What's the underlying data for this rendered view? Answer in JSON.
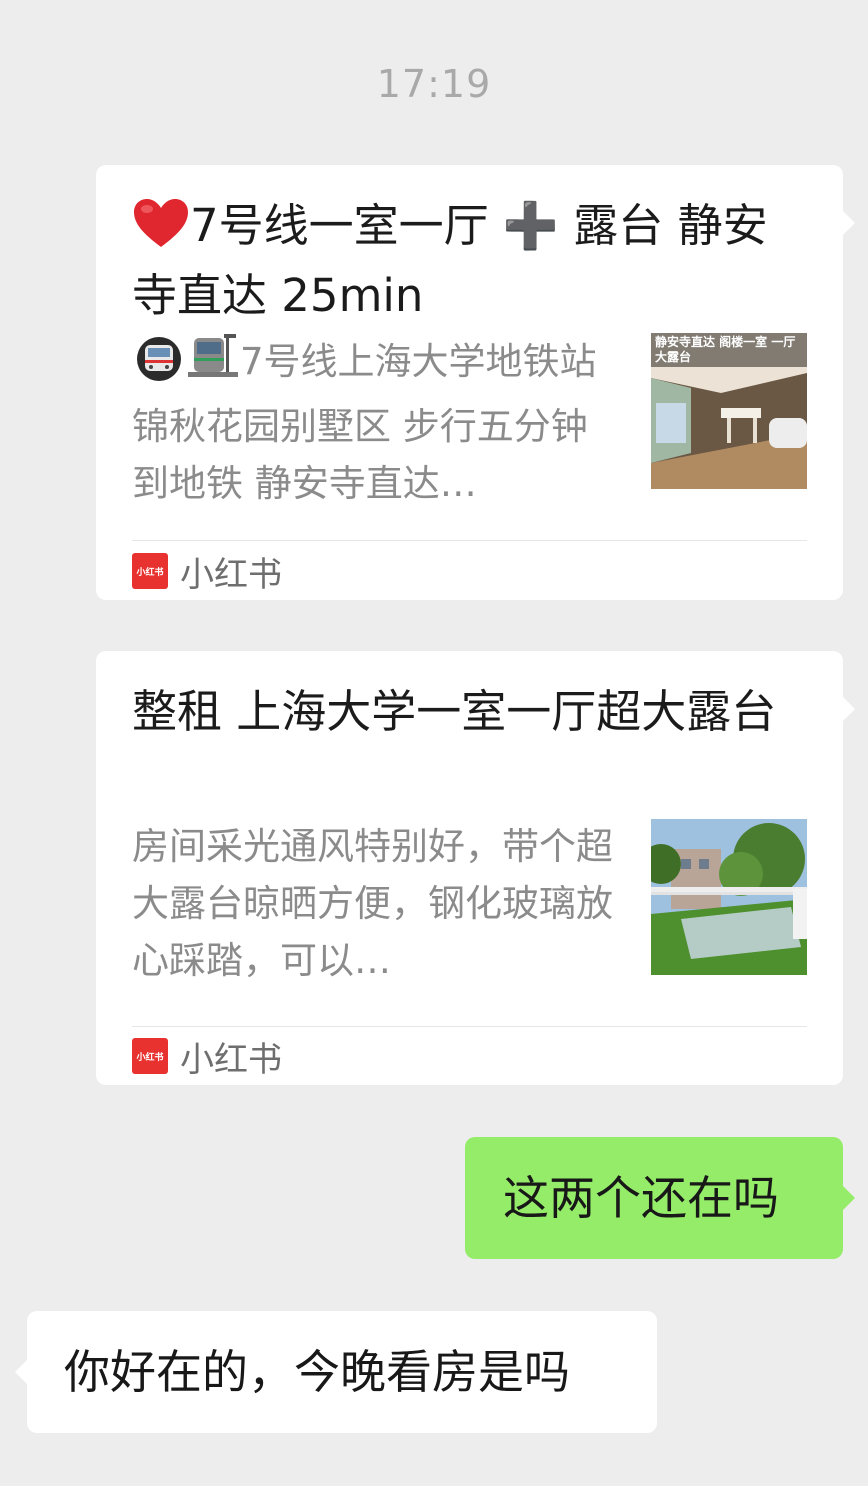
{
  "chat": {
    "timestamp": "17:19",
    "cards": [
      {
        "title_emoji": "heart-emoji",
        "title": "7号线一室一厅 ➕ 露台 静安寺直达 25min",
        "desc_emojis": [
          "metro-emoji",
          "train-emoji"
        ],
        "description": "7号线上海大学地铁站 锦秋花园别墅区 步行五分钟到地铁 静安寺直达…",
        "thumbnail_caption": "静安寺直达 阁楼一室 一厅 大露台",
        "source": "小红书",
        "source_logo_text": "小红书"
      },
      {
        "title": "整租 上海大学一室一厅超大露台",
        "description": "房间采光通风特别好，带个超大露台晾晒方便，钢化玻璃放心踩踏，可以…",
        "source": "小红书",
        "source_logo_text": "小红书"
      }
    ],
    "messages": [
      {
        "from": "me",
        "text": "这两个还在吗"
      },
      {
        "from": "other",
        "text": "你好在的，今晚看房是吗"
      }
    ],
    "colors": {
      "background": "#ededed",
      "my_bubble": "#95ec69",
      "other_bubble": "#ffffff",
      "source_brand": "#e8322f"
    }
  }
}
